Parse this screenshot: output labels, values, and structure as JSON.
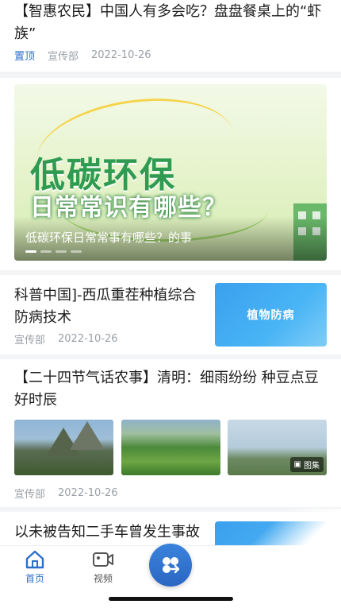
{
  "articles": [
    {
      "title": "【智惠农民】中国人有多会吃？盘盘餐桌上的“虾族”",
      "tag": "置顶",
      "source": "宣传部",
      "date": "2022-10-26"
    },
    {
      "title": "科普中国]-西瓜重茬种植综合防病技术",
      "source": "宣传部",
      "date": "2022-10-26",
      "thumb_text": "植物防病"
    },
    {
      "title": "【二十四节气话农事】清明：细雨纷纷 种豆点豆好时辰",
      "source": "宣传部",
      "date": "2022-10-26",
      "gallery_label": "图集"
    },
    {
      "title": "以未被告知二手车曾发生事故"
    }
  ],
  "banner": {
    "headline": "低碳环保",
    "subline": "日常常识有哪些？",
    "caption": "低碳环保日常常事有哪些？的事",
    "slide_count": 4,
    "active_slide": 1
  },
  "tabbar": {
    "home_label": "首页",
    "video_label": "视频",
    "home_icon": "home-icon",
    "video_icon": "video-icon",
    "center_icon": "apps-switch-icon"
  },
  "colors": {
    "accent": "#2d6fc9",
    "meta": "#9aa0a6",
    "banner_green": "#2f9b51"
  }
}
